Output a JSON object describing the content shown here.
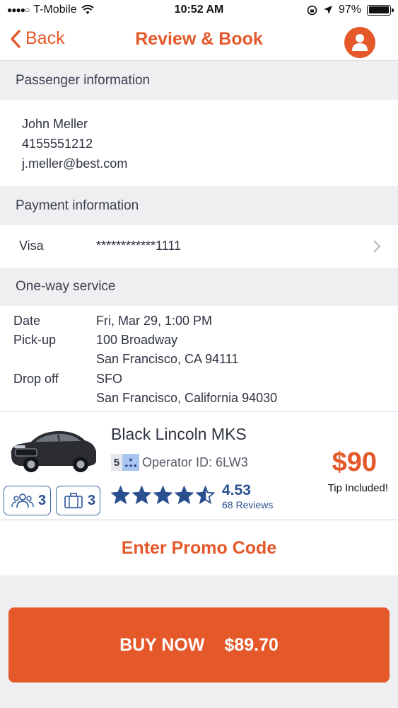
{
  "status": {
    "carrier": "T-Mobile",
    "time": "10:52 AM",
    "battery": "97%",
    "battery_level": 0.97
  },
  "nav": {
    "back_label": "Back",
    "title": "Review & Book",
    "account_icon": "user-icon"
  },
  "passenger": {
    "header": "Passenger information",
    "name": "John Meller",
    "phone": "4155551212",
    "email": "j.meller@best.com"
  },
  "payment": {
    "header": "Payment information",
    "card_type": "Visa",
    "card_number": "************1111"
  },
  "service": {
    "header": "One-way service",
    "date_label": "Date",
    "date_value": "Fri, Mar 29, 1:00 PM",
    "pickup_label": "Pick-up",
    "pickup_line1": "100 Broadway",
    "pickup_line2": "San Francisco, CA 94111",
    "dropoff_label": "Drop off",
    "dropoff_line1": "SFO",
    "dropoff_line2": "San Francisco, California 94030"
  },
  "vehicle": {
    "name": "Black Lincoln MKS",
    "operator_badge_level": "5",
    "operator_id": "Operator ID: 6LW3",
    "passengers": "3",
    "luggage": "3",
    "rating": "4.53",
    "rating_value": 4.53,
    "reviews": "68 Reviews",
    "price": "$90",
    "tip_note": "Tip Included!"
  },
  "promo": {
    "label": "Enter Promo Code"
  },
  "buy": {
    "label": "BUY NOW",
    "amount": "$89.70"
  },
  "colors": {
    "accent": "#e4582a",
    "blue": "#2a4f8f",
    "background": "#efeff1"
  }
}
